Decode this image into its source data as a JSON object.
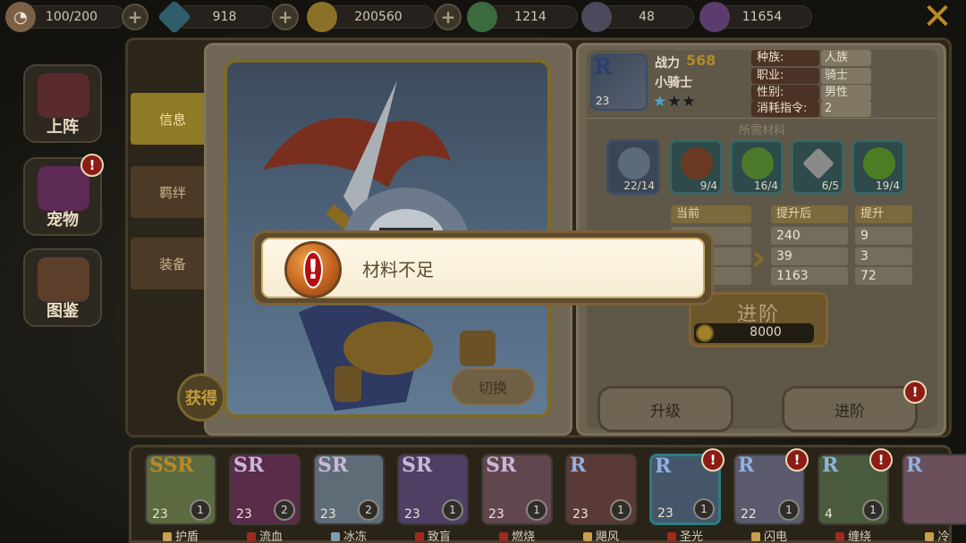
{
  "topbar": {
    "stamina": "100/200",
    "gems": "918",
    "coins": "200560",
    "candy": "1214",
    "rank": "48",
    "stars": "11654",
    "plus_label": "+",
    "close_label": "✕"
  },
  "sidenav": [
    {
      "label": "上阵",
      "badge": ""
    },
    {
      "label": "宠物",
      "badge": "!"
    },
    {
      "label": "图鉴",
      "badge": ""
    }
  ],
  "tabs": [
    {
      "label": "信息",
      "active": true
    },
    {
      "label": "羁绊",
      "active": false
    },
    {
      "label": "装备",
      "active": false
    }
  ],
  "hero_view": {
    "switch_label": "切换",
    "obtain_label": "获得"
  },
  "hero_info": {
    "rarity": "R",
    "level": "23",
    "power_label": "战力",
    "power_value": "568",
    "name": "小骑士",
    "stars_filled": 1,
    "stars_total": 3,
    "attributes": [
      {
        "label": "种族:",
        "value": "人族"
      },
      {
        "label": "职业:",
        "value": "骑士"
      },
      {
        "label": "性别:",
        "value": "男性"
      },
      {
        "label": "消耗指令:",
        "value": "2"
      }
    ]
  },
  "materials": {
    "title": "所需材料",
    "items": [
      {
        "icon": "knight-shard-icon",
        "count": "22/14"
      },
      {
        "icon": "boar-icon",
        "count": "9/4"
      },
      {
        "icon": "green-potion-icon",
        "count": "16/4"
      },
      {
        "icon": "kunai-icon",
        "count": "6/5"
      },
      {
        "icon": "green-slime-icon",
        "count": "19/4"
      }
    ]
  },
  "stats": {
    "headers": {
      "current": "当前",
      "after": "提升后",
      "increase": "提升"
    },
    "rows": [
      {
        "current": "",
        "after": "240",
        "increase": "9"
      },
      {
        "current": "",
        "after": "39",
        "increase": "3"
      },
      {
        "current": "",
        "after": "1163",
        "increase": "72"
      }
    ]
  },
  "advance": {
    "label": "进阶",
    "cost": "8000"
  },
  "buttons": {
    "upgrade": "升级",
    "advance": "进阶",
    "advance_badge": "!"
  },
  "toast": {
    "message": "材料不足",
    "icon_glyph": "!"
  },
  "roster": [
    {
      "rarity": "SSR",
      "level": "23",
      "rank": "1",
      "skill": "护盾",
      "color": "#5c6a3f",
      "skill_color": "#c9a04d",
      "badge": ""
    },
    {
      "rarity": "SR",
      "level": "23",
      "rank": "2",
      "skill": "流血",
      "color": "#5b2b4a",
      "skill_color": "#9d2b20",
      "badge": ""
    },
    {
      "rarity": "SR",
      "level": "23",
      "rank": "2",
      "skill": "冰冻",
      "color": "#5e6c78",
      "skill_color": "#7d9db5",
      "badge": ""
    },
    {
      "rarity": "SR",
      "level": "23",
      "rank": "1",
      "skill": "致盲",
      "color": "#4f3f64",
      "skill_color": "#9d2b20",
      "badge": ""
    },
    {
      "rarity": "SR",
      "level": "23",
      "rank": "1",
      "skill": "燃烧",
      "color": "#62464e",
      "skill_color": "#9d2b20",
      "badge": ""
    },
    {
      "rarity": "R",
      "level": "23",
      "rank": "1",
      "skill": "飓风",
      "color": "#5a3a36",
      "skill_color": "#c9a04d",
      "badge": ""
    },
    {
      "rarity": "R",
      "level": "23",
      "rank": "1",
      "skill": "圣光",
      "color": "#45566a",
      "skill_color": "#9d2b20",
      "badge": "!"
    },
    {
      "rarity": "R",
      "level": "22",
      "rank": "1",
      "skill": "闪电",
      "color": "#5b5a6c",
      "skill_color": "#c9a04d",
      "badge": "!"
    },
    {
      "rarity": "R",
      "level": "4",
      "rank": "1",
      "skill": "缠绕",
      "color": "#4a5a3c",
      "skill_color": "#9d2b20",
      "badge": "!"
    },
    {
      "rarity": "R",
      "level": "",
      "rank": "",
      "skill": "冷",
      "color": "#6a4e5a",
      "skill_color": "#c9a04d",
      "badge": ""
    }
  ],
  "colors": {
    "accent_gold": "#b18c2d",
    "badge_red": "#8d1b16",
    "toast_bg": "#fdf7e6"
  }
}
